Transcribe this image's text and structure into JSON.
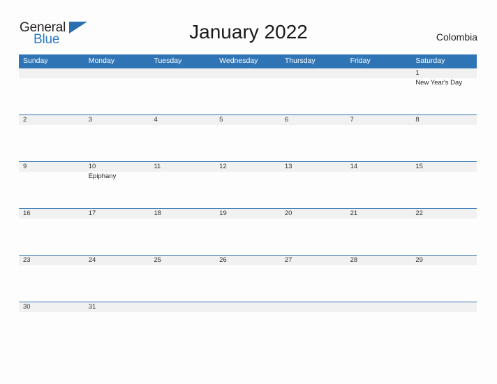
{
  "brand": {
    "name_part1": "General",
    "name_part2": "Blue",
    "triangle_icon": "triangle-icon",
    "colors": {
      "general_text": "#231f20",
      "blue_text": "#2a7ac4",
      "triangle": "#2a6fb0"
    }
  },
  "header": {
    "title": "January 2022",
    "country": "Colombia"
  },
  "theme": {
    "header_blue": "#2f74b5",
    "band_gray": "#f1f1f1",
    "page_background": "#fdfdfd",
    "text": "#333333"
  },
  "calendar": {
    "month": "January",
    "year": "2022",
    "weekdays": [
      "Sunday",
      "Monday",
      "Tuesday",
      "Wednesday",
      "Thursday",
      "Friday",
      "Saturday"
    ],
    "weeks": [
      [
        {
          "day": "",
          "event": ""
        },
        {
          "day": "",
          "event": ""
        },
        {
          "day": "",
          "event": ""
        },
        {
          "day": "",
          "event": ""
        },
        {
          "day": "",
          "event": ""
        },
        {
          "day": "",
          "event": ""
        },
        {
          "day": "1",
          "event": "New Year's Day"
        }
      ],
      [
        {
          "day": "2",
          "event": ""
        },
        {
          "day": "3",
          "event": ""
        },
        {
          "day": "4",
          "event": ""
        },
        {
          "day": "5",
          "event": ""
        },
        {
          "day": "6",
          "event": ""
        },
        {
          "day": "7",
          "event": ""
        },
        {
          "day": "8",
          "event": ""
        }
      ],
      [
        {
          "day": "9",
          "event": ""
        },
        {
          "day": "10",
          "event": "Epiphany"
        },
        {
          "day": "11",
          "event": ""
        },
        {
          "day": "12",
          "event": ""
        },
        {
          "day": "13",
          "event": ""
        },
        {
          "day": "14",
          "event": ""
        },
        {
          "day": "15",
          "event": ""
        }
      ],
      [
        {
          "day": "16",
          "event": ""
        },
        {
          "day": "17",
          "event": ""
        },
        {
          "day": "18",
          "event": ""
        },
        {
          "day": "19",
          "event": ""
        },
        {
          "day": "20",
          "event": ""
        },
        {
          "day": "21",
          "event": ""
        },
        {
          "day": "22",
          "event": ""
        }
      ],
      [
        {
          "day": "23",
          "event": ""
        },
        {
          "day": "24",
          "event": ""
        },
        {
          "day": "25",
          "event": ""
        },
        {
          "day": "26",
          "event": ""
        },
        {
          "day": "27",
          "event": ""
        },
        {
          "day": "28",
          "event": ""
        },
        {
          "day": "29",
          "event": ""
        }
      ],
      [
        {
          "day": "30",
          "event": ""
        },
        {
          "day": "31",
          "event": ""
        },
        {
          "day": "",
          "event": ""
        },
        {
          "day": "",
          "event": ""
        },
        {
          "day": "",
          "event": ""
        },
        {
          "day": "",
          "event": ""
        },
        {
          "day": "",
          "event": ""
        }
      ]
    ]
  }
}
